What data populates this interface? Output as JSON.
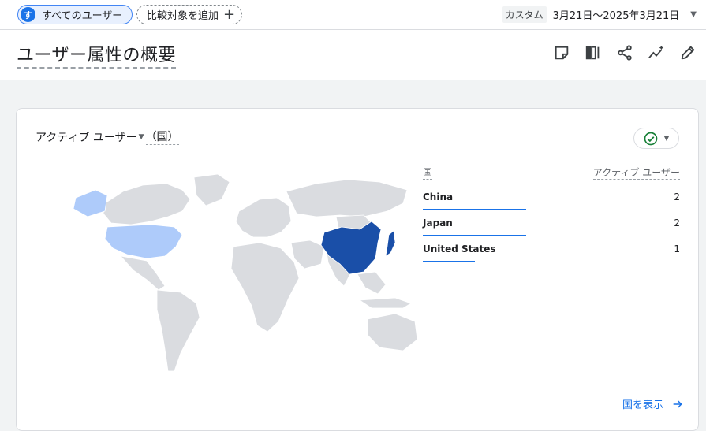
{
  "filters": {
    "users_chip_avatar": "す",
    "users_chip_label": "すべてのユーザー",
    "compare_label": "比較対象を追加",
    "compare_icon": "plus-icon"
  },
  "date": {
    "custom_label": "カスタム",
    "range": "3月21日〜2025年3月21日"
  },
  "page": {
    "title": "ユーザー属性の概要",
    "tools": [
      "report-icon",
      "compare-columns-icon",
      "share-icon",
      "insights-icon",
      "edit-icon"
    ]
  },
  "card": {
    "metric": "アクティブ ユーザー",
    "dimension": "（国）",
    "status_icon": "check-circle-icon",
    "table": {
      "headers": [
        "国",
        "アクティブ ユーザー"
      ],
      "rows": [
        {
          "country": "China",
          "value": "2",
          "share": 1.0
        },
        {
          "country": "Japan",
          "value": "2",
          "share": 1.0
        },
        {
          "country": "United States",
          "value": "1",
          "share": 0.5
        }
      ]
    },
    "view_link": "国を表示"
  },
  "colors": {
    "accent": "#1a73e8",
    "map_high": "#1a4fa8",
    "map_low": "#aecbfa",
    "map_none": "#dadce0"
  }
}
